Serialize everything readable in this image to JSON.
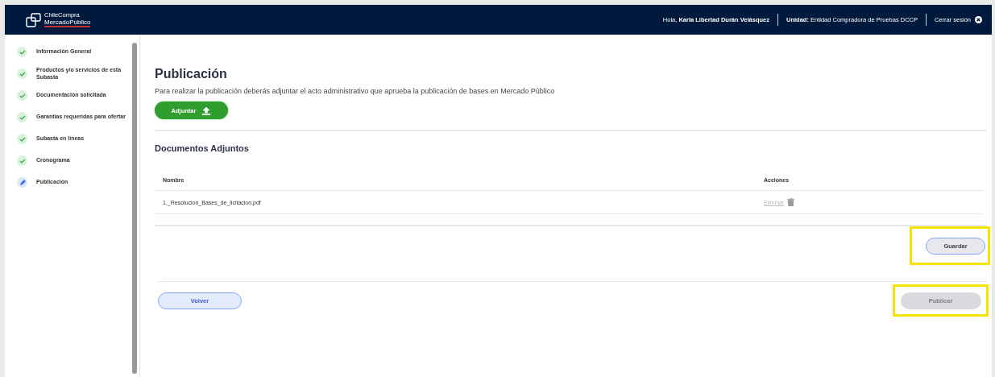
{
  "header": {
    "logo_small": "ChileCompra",
    "logo": "MercadoPúblico",
    "greeting": "Hola, **Karla Libertad Durán Velásquez**",
    "unit": "**Unidad:** Entidad Compradora de Pruebas DCCP",
    "logout": "Cerrar sesión"
  },
  "sidebar": {
    "items": [
      {
        "label": "Información General",
        "completed": true
      },
      {
        "label": "Productos y/o servicios de esta Subasta",
        "completed": true
      },
      {
        "label": "Documentación solicitada",
        "completed": true
      },
      {
        "label": "Garantías requeridas para ofertar",
        "completed": true
      },
      {
        "label": "Subasta en líneas",
        "completed": true
      },
      {
        "label": "Cronograma",
        "completed": true
      },
      {
        "label": "Publicación",
        "completed": false
      }
    ]
  },
  "main": {
    "title": "Publicación",
    "description": "Para realizar la publicación deberás adjuntar el acto administrativo que aprueba la publicación de bases en Mercado Público",
    "attach_button": "Adjuntar",
    "attachments_title": "Documentos Adjuntos",
    "table": {
      "columns": [
        "Nombre",
        "Acciones"
      ],
      "rows": [
        {
          "name": "1._Resolucion_Bases_de_licitacion.pdf",
          "action": "Eliminar",
          "action_disabled": true
        }
      ]
    },
    "save_button": {
      "label": "Guardar",
      "highlighted": true
    },
    "back_button": {
      "label": "Volver"
    },
    "publish_button": {
      "label": "Publicar",
      "disabled": true,
      "highlighted": true
    }
  }
}
